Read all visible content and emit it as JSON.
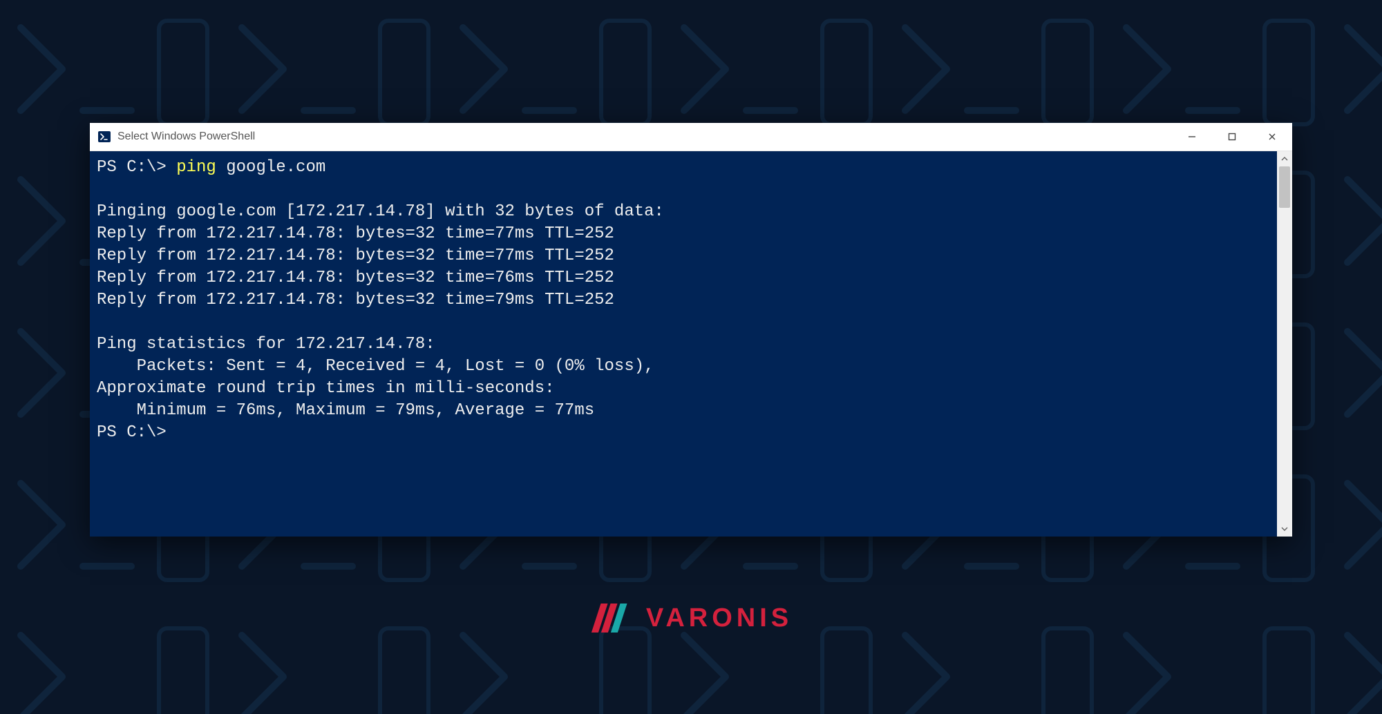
{
  "window": {
    "title": "Select Windows PowerShell"
  },
  "terminal": {
    "prompt1_prefix": "PS C:\\> ",
    "prompt1_cmd": "ping",
    "prompt1_args": " google.com",
    "blank1": "",
    "line_pinging": "Pinging google.com [172.217.14.78] with 32 bytes of data:",
    "reply1": "Reply from 172.217.14.78: bytes=32 time=77ms TTL=252",
    "reply2": "Reply from 172.217.14.78: bytes=32 time=77ms TTL=252",
    "reply3": "Reply from 172.217.14.78: bytes=32 time=76ms TTL=252",
    "reply4": "Reply from 172.217.14.78: bytes=32 time=79ms TTL=252",
    "blank2": "",
    "stats_header": "Ping statistics for 172.217.14.78:",
    "stats_packets": "    Packets: Sent = 4, Received = 4, Lost = 0 (0% loss),",
    "rtt_header": "Approximate round trip times in milli-seconds:",
    "rtt_values": "    Minimum = 76ms, Maximum = 79ms, Average = 77ms",
    "prompt2": "PS C:\\>"
  },
  "branding": {
    "name": "VARONIS"
  },
  "colors": {
    "console_bg": "#012456",
    "console_fg": "#eeeeee",
    "cmd_highlight": "#ffff55",
    "brand_red": "#d4213d",
    "brand_teal": "#1aa8a8",
    "page_bg": "#0a1628"
  }
}
